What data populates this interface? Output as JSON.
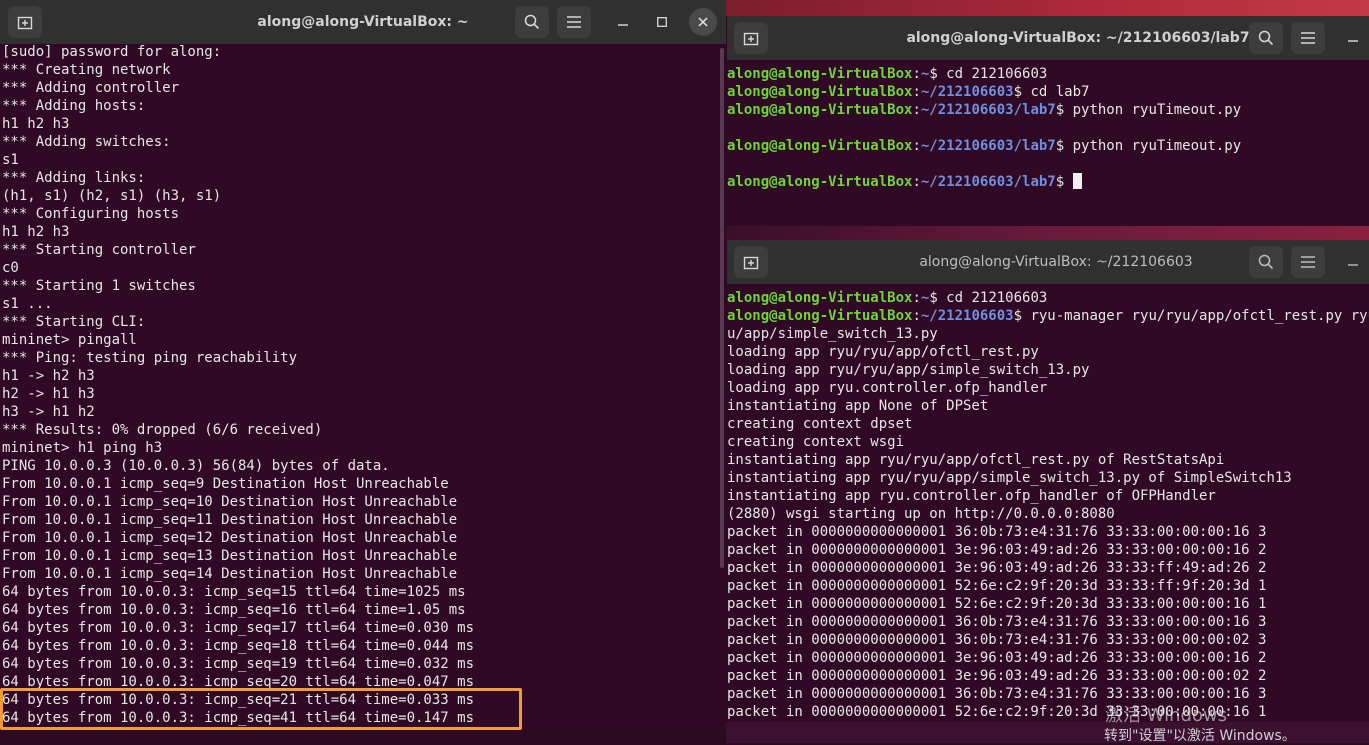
{
  "left": {
    "title": "along@along-VirtualBox: ~",
    "lines": [
      "[sudo] password for along:",
      "*** Creating network",
      "*** Adding controller",
      "*** Adding hosts:",
      "h1 h2 h3",
      "*** Adding switches:",
      "s1",
      "*** Adding links:",
      "(h1, s1) (h2, s1) (h3, s1)",
      "*** Configuring hosts",
      "h1 h2 h3",
      "*** Starting controller",
      "c0",
      "*** Starting 1 switches",
      "s1 ...",
      "*** Starting CLI:",
      "mininet> pingall",
      "*** Ping: testing ping reachability",
      "h1 -> h2 h3",
      "h2 -> h1 h3",
      "h3 -> h1 h2",
      "*** Results: 0% dropped (6/6 received)",
      "mininet> h1 ping h3",
      "PING 10.0.0.3 (10.0.0.3) 56(84) bytes of data.",
      "From 10.0.0.1 icmp_seq=9 Destination Host Unreachable",
      "From 10.0.0.1 icmp_seq=10 Destination Host Unreachable",
      "From 10.0.0.1 icmp_seq=11 Destination Host Unreachable",
      "From 10.0.0.1 icmp_seq=12 Destination Host Unreachable",
      "From 10.0.0.1 icmp_seq=13 Destination Host Unreachable",
      "From 10.0.0.1 icmp_seq=14 Destination Host Unreachable",
      "64 bytes from 10.0.0.3: icmp_seq=15 ttl=64 time=1025 ms",
      "64 bytes from 10.0.0.3: icmp_seq=16 ttl=64 time=1.05 ms",
      "64 bytes from 10.0.0.3: icmp_seq=17 ttl=64 time=0.030 ms",
      "64 bytes from 10.0.0.3: icmp_seq=18 ttl=64 time=0.044 ms",
      "64 bytes from 10.0.0.3: icmp_seq=19 ttl=64 time=0.032 ms",
      "64 bytes from 10.0.0.3: icmp_seq=20 ttl=64 time=0.047 ms",
      "64 bytes from 10.0.0.3: icmp_seq=21 ttl=64 time=0.033 ms",
      "64 bytes from 10.0.0.3: icmp_seq=41 ttl=64 time=0.147 ms"
    ]
  },
  "top_right": {
    "title": "along@along-VirtualBox: ~/212106603/lab7",
    "lines": [
      {
        "user": "along@along-VirtualBox",
        "path": "~",
        "cmd": "$ cd 212106603"
      },
      {
        "user": "along@along-VirtualBox",
        "path": "~/212106603",
        "cmd": "$ cd lab7"
      },
      {
        "user": "along@along-VirtualBox",
        "path": "~/212106603/lab7",
        "cmd": "$ python ryuTimeout.py"
      },
      {
        "user": "",
        "path": "",
        "cmd": ""
      },
      {
        "user": "along@along-VirtualBox",
        "path": "~/212106603/lab7",
        "cmd": "$ python ryuTimeout.py"
      },
      {
        "user": "",
        "path": "",
        "cmd": ""
      },
      {
        "user": "along@along-VirtualBox",
        "path": "~/212106603/lab7",
        "cmd": "$ "
      }
    ]
  },
  "bottom_right": {
    "title": "along@along-VirtualBox: ~/212106603",
    "prompt_lines": [
      {
        "user": "along@along-VirtualBox",
        "path": "~",
        "cmd": "$ cd 212106603"
      },
      {
        "user": "along@along-VirtualBox",
        "path": "~/212106603",
        "cmd": "$ ryu-manager ryu/ryu/app/ofctl_rest.py ryu/ryu/app/simple_switch_13.py"
      }
    ],
    "lines": [
      "u/app/simple_switch_13.py",
      "loading app ryu/ryu/app/ofctl_rest.py",
      "loading app ryu/ryu/app/simple_switch_13.py",
      "loading app ryu.controller.ofp_handler",
      "instantiating app None of DPSet",
      "creating context dpset",
      "creating context wsgi",
      "instantiating app ryu/ryu/app/ofctl_rest.py of RestStatsApi",
      "instantiating app ryu/ryu/app/simple_switch_13.py of SimpleSwitch13",
      "instantiating app ryu.controller.ofp_handler of OFPHandler",
      "(2880) wsgi starting up on http://0.0.0.0:8080",
      "packet in 0000000000000001 36:0b:73:e4:31:76 33:33:00:00:00:16 3",
      "packet in 0000000000000001 3e:96:03:49:ad:26 33:33:00:00:00:16 2",
      "packet in 0000000000000001 3e:96:03:49:ad:26 33:33:ff:49:ad:26 2",
      "packet in 0000000000000001 52:6e:c2:9f:20:3d 33:33:ff:9f:20:3d 1",
      "packet in 0000000000000001 52:6e:c2:9f:20:3d 33:33:00:00:00:16 1",
      "packet in 0000000000000001 36:0b:73:e4:31:76 33:33:00:00:00:16 3",
      "packet in 0000000000000001 36:0b:73:e4:31:76 33:33:00:00:00:02 3",
      "packet in 0000000000000001 3e:96:03:49:ad:26 33:33:00:00:00:16 2",
      "packet in 0000000000000001 3e:96:03:49:ad:26 33:33:00:00:00:02 2",
      "packet in 0000000000000001 36:0b:73:e4:31:76 33:33:00:00:00:16 3",
      "packet in 0000000000000001 52:6e:c2:9f:20:3d 33:33:00:00:00:16 1"
    ]
  },
  "watermark": {
    "line1": "激活 Windows",
    "line2": "转到\"设置\"以激活 Windows。"
  },
  "colors": {
    "terminal_bg": "#300a24",
    "titlebar_bg": "#303030",
    "prompt_user": "#6ed437",
    "prompt_path": "#6f8fe0",
    "highlight": "#f39c34"
  },
  "icons": [
    "new-tab-icon",
    "search-icon",
    "hamburger-menu-icon",
    "minimize-icon",
    "maximize-icon",
    "close-icon"
  ]
}
